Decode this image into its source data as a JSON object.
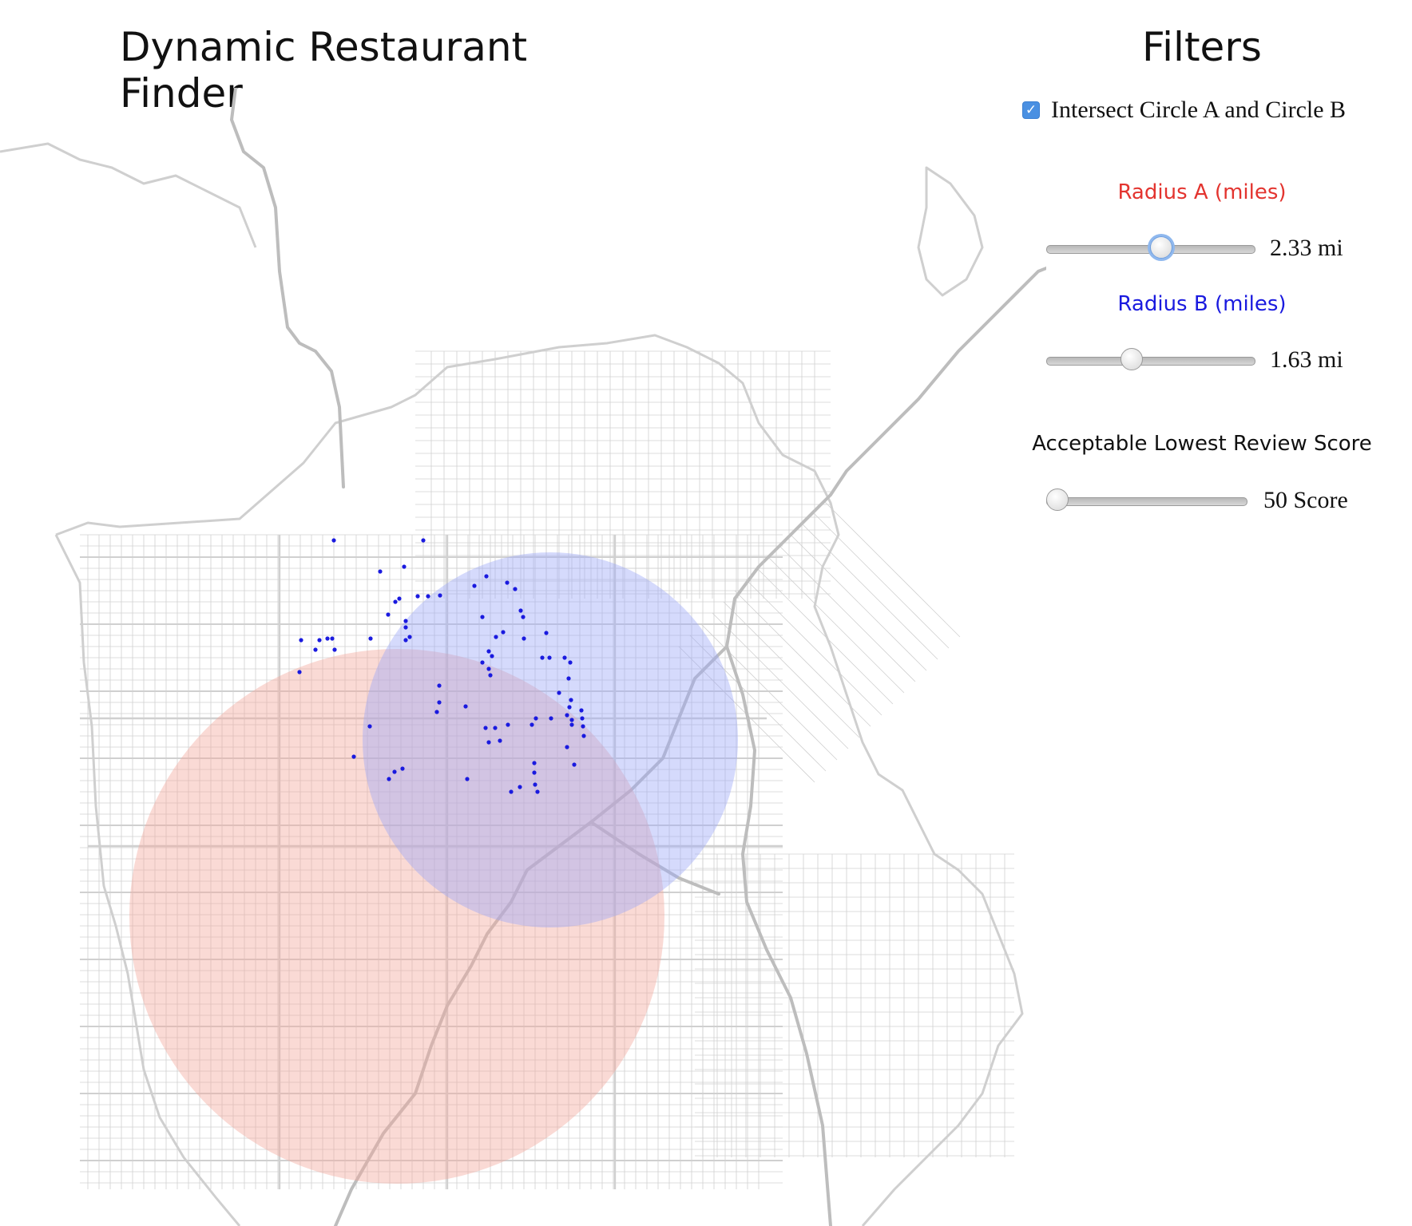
{
  "app": {
    "title": "Dynamic Restaurant Finder"
  },
  "filters": {
    "title": "Filters",
    "intersect": {
      "label": "Intersect Circle A and Circle B",
      "checked": true
    },
    "radius_a": {
      "label": "Radius A (miles)",
      "value_text": "2.33 mi",
      "label_color": "#e3342f",
      "fill_fraction": 0.56
    },
    "radius_b": {
      "label": "Radius B (miles)",
      "value_text": "1.63 mi",
      "label_color": "#1a1adf",
      "fill_fraction": 0.4
    },
    "review_score": {
      "label": "Acceptable Lowest Review Score",
      "value_text": "50 Score",
      "fill_fraction": 0.0
    }
  },
  "map": {
    "circle_a_color": "#f4a79a",
    "circle_b_color": "#9aa6f8",
    "restaurant_dot_color": "#1a1adf",
    "street_color": "#d0d0d0",
    "highway_color": "#b8b8b8"
  }
}
